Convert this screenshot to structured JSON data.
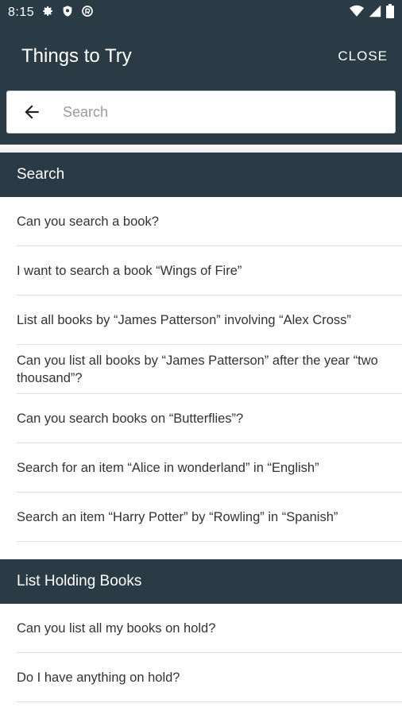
{
  "status_bar": {
    "time": "8:15",
    "icons": [
      "settings-icon",
      "shield-icon",
      "accessibility-icon",
      "wifi-icon",
      "signal-icon",
      "battery-icon"
    ]
  },
  "app_bar": {
    "title": "Things to Try",
    "close_label": "CLOSE"
  },
  "search": {
    "placeholder": "Search",
    "value": ""
  },
  "sections": [
    {
      "title": "Search",
      "items": [
        "Can you search a book?",
        "I want to search a book “Wings of Fire”",
        "List all books by “James Patterson” involving “Alex Cross”",
        "Can you list all books by “James Patterson” after the year “two thousand”?",
        "Can you search books on “Butterflies”?",
        "Search for an item “Alice in wonderland” in “English”",
        "Search an item “Harry Potter” by “Rowling” in “Spanish”"
      ]
    },
    {
      "title": "List Holding Books",
      "items": [
        "Can you list all my books on hold?",
        "Do I have anything on hold?"
      ]
    }
  ],
  "colors": {
    "header_bg": "#2b3b45",
    "text": "#333333",
    "divider": "#e0e0e0"
  }
}
